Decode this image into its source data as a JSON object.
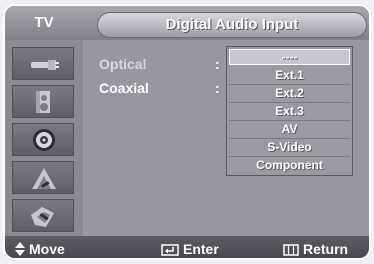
{
  "header": {
    "tv_label": "TV",
    "title": "Digital Audio Input"
  },
  "sidebar": {
    "items": [
      {
        "icon": "antenna-plug-icon"
      },
      {
        "icon": "speaker-icon"
      },
      {
        "icon": "sound-disc-icon"
      },
      {
        "icon": "setup-tools-icon"
      },
      {
        "icon": "channel-settings-icon"
      }
    ]
  },
  "options": [
    {
      "label": "Optical",
      "colon": ":"
    },
    {
      "label": "Coaxial",
      "colon": ":"
    }
  ],
  "dropdown": {
    "items": [
      "----",
      "Ext.1",
      "Ext.2",
      "Ext.3",
      "AV",
      "S-Video",
      "Component"
    ],
    "selected_index": 0
  },
  "footer": {
    "move": "Move",
    "enter": "Enter",
    "return": "Return"
  },
  "colors": {
    "optical_label": "#d8d7df",
    "coaxial_label": "#ffffff",
    "header_text": "#ffffff"
  }
}
